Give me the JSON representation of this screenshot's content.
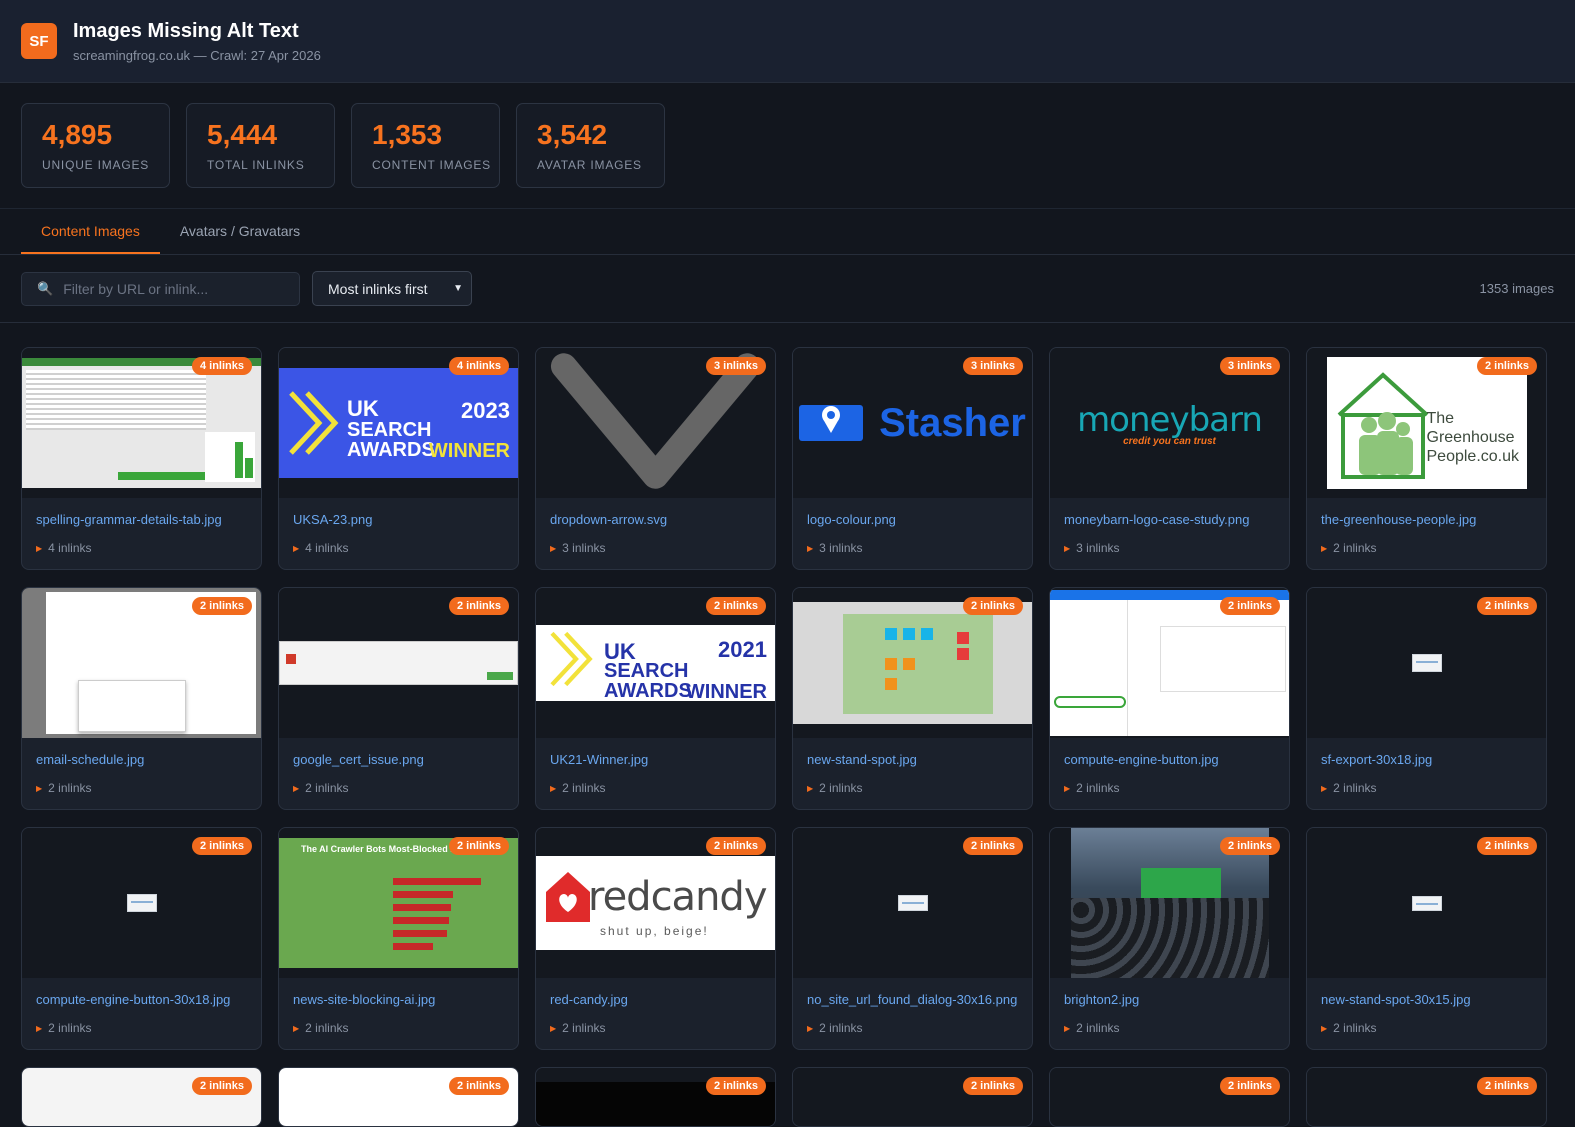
{
  "header": {
    "logo": "SF",
    "title": "Images Missing Alt Text",
    "subtitle": "screamingfrog.co.uk — Crawl: 27 Apr 2026"
  },
  "stats": [
    {
      "value": "4,895",
      "label": "UNIQUE IMAGES"
    },
    {
      "value": "5,444",
      "label": "TOTAL INLINKS"
    },
    {
      "value": "1,353",
      "label": "CONTENT IMAGES"
    },
    {
      "value": "3,542",
      "label": "AVATAR IMAGES"
    }
  ],
  "tabs": [
    {
      "label": "Content Images",
      "active": true
    },
    {
      "label": "Avatars / Gravatars",
      "active": false
    }
  ],
  "toolbar": {
    "search_placeholder": "Filter by URL or inlink...",
    "sort_selected": "Most inlinks first",
    "count": "1353 images"
  },
  "cards": [
    {
      "badge": "4 inlinks",
      "filename": "spelling-grammar-details-tab.jpg",
      "inlinks": "4 inlinks"
    },
    {
      "badge": "4 inlinks",
      "filename": "UKSA-23.png",
      "inlinks": "4 inlinks",
      "art": {
        "uk": "UK",
        "year": "2023",
        "line": "SEARCH AWARDS",
        "win": "WINNER"
      }
    },
    {
      "badge": "3 inlinks",
      "filename": "dropdown-arrow.svg",
      "inlinks": "3 inlinks"
    },
    {
      "badge": "3 inlinks",
      "filename": "logo-colour.png",
      "inlinks": "3 inlinks",
      "art": {
        "text": "Stasher"
      }
    },
    {
      "badge": "3 inlinks",
      "filename": "moneybarn-logo-case-study.png",
      "inlinks": "3 inlinks",
      "art": {
        "text": "moneybarn",
        "tag": "credit you can trust"
      }
    },
    {
      "badge": "2 inlinks",
      "filename": "the-greenhouse-people.jpg",
      "inlinks": "2 inlinks",
      "art": {
        "l1": "The",
        "l2": "Greenhouse",
        "l3": "People.co.uk"
      }
    },
    {
      "badge": "2 inlinks",
      "filename": "email-schedule.jpg",
      "inlinks": "2 inlinks"
    },
    {
      "badge": "2 inlinks",
      "filename": "google_cert_issue.png",
      "inlinks": "2 inlinks"
    },
    {
      "badge": "2 inlinks",
      "filename": "UK21-Winner.jpg",
      "inlinks": "2 inlinks",
      "art": {
        "uk": "UK",
        "year": "2021",
        "line": "SEARCH AWARDS",
        "win": "WINNER"
      }
    },
    {
      "badge": "2 inlinks",
      "filename": "new-stand-spot.jpg",
      "inlinks": "2 inlinks"
    },
    {
      "badge": "2 inlinks",
      "filename": "compute-engine-button.jpg",
      "inlinks": "2 inlinks"
    },
    {
      "badge": "2 inlinks",
      "filename": "sf-export-30x18.jpg",
      "inlinks": "2 inlinks"
    },
    {
      "badge": "2 inlinks",
      "filename": "compute-engine-button-30x18.jpg",
      "inlinks": "2 inlinks"
    },
    {
      "badge": "2 inlinks",
      "filename": "news-site-blocking-ai.jpg",
      "inlinks": "2 inlinks",
      "art": {
        "title": "The AI Crawler Bots Most-Blocked By"
      }
    },
    {
      "badge": "2 inlinks",
      "filename": "red-candy.jpg",
      "inlinks": "2 inlinks",
      "art": {
        "text": "redcandy",
        "tag": "shut up, beige!"
      }
    },
    {
      "badge": "2 inlinks",
      "filename": "no_site_url_found_dialog-30x16.png",
      "inlinks": "2 inlinks"
    },
    {
      "badge": "2 inlinks",
      "filename": "brighton2.jpg",
      "inlinks": "2 inlinks"
    },
    {
      "badge": "2 inlinks",
      "filename": "new-stand-spot-30x15.jpg",
      "inlinks": "2 inlinks"
    }
  ],
  "partial_badges": [
    "2 inlinks",
    "2 inlinks",
    "2 inlinks",
    "2 inlinks",
    "2 inlinks",
    "2 inlinks"
  ],
  "colors": {
    "accent": "#f26b1d",
    "link": "#6aa7ef",
    "background": "#12161e"
  }
}
